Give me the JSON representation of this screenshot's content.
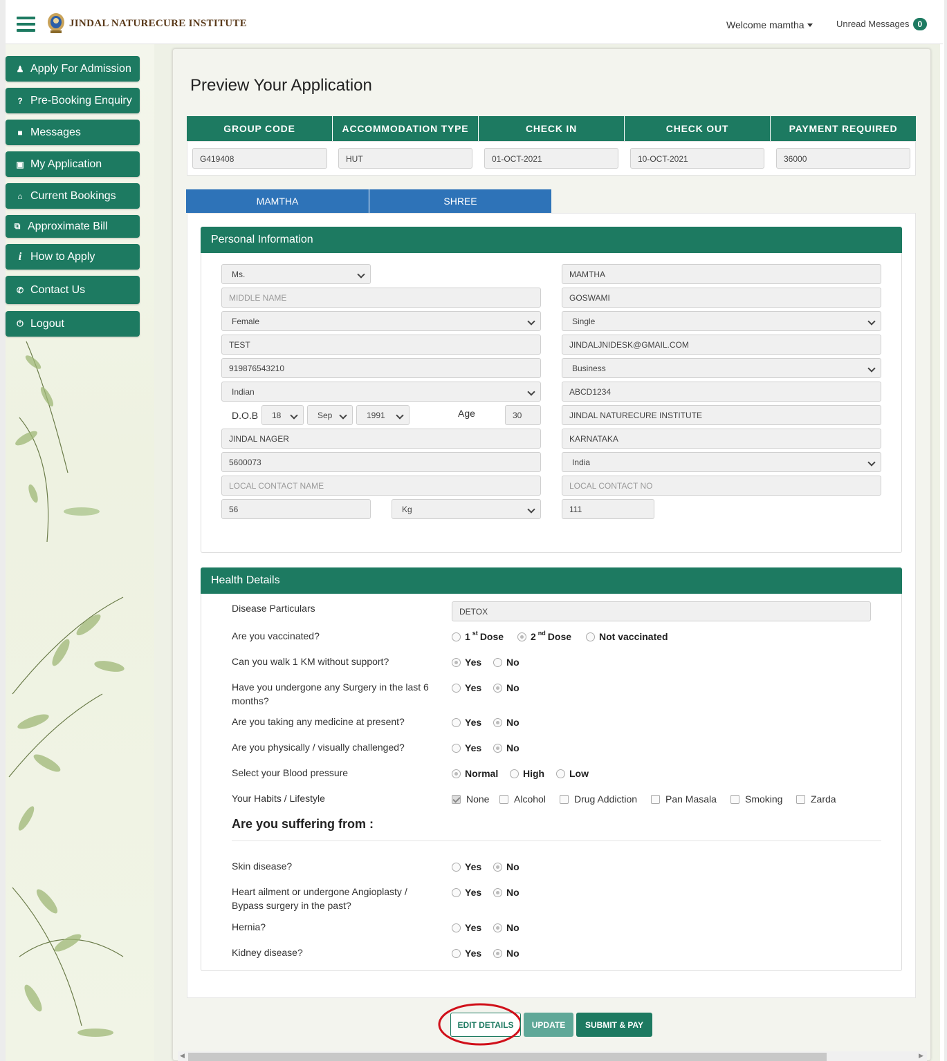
{
  "header": {
    "brand": "JINDAL NATURECURE INSTITUTE",
    "welcome": "Welcome mamtha",
    "unread_label": "Unread Messages",
    "unread_count": "0"
  },
  "sidebar": {
    "items": [
      {
        "label": "Apply For Admission",
        "icon": "user-icon"
      },
      {
        "label": "Pre-Booking Enquiry",
        "icon": "question-icon"
      },
      {
        "label": "Messages",
        "icon": "message-icon"
      },
      {
        "label": "My Application",
        "icon": "document-icon"
      },
      {
        "label": "Current Bookings",
        "icon": "home-icon"
      },
      {
        "label": "Approximate Bill",
        "icon": "copy-icon"
      },
      {
        "label": "How to Apply",
        "icon": "info-icon"
      },
      {
        "label": "Contact Us",
        "icon": "phone-icon"
      },
      {
        "label": "Logout",
        "icon": "power-icon"
      }
    ]
  },
  "page": {
    "title": "Preview Your Application"
  },
  "summary": {
    "headers": [
      "GROUP CODE",
      "ACCOMMODATION TYPE",
      "CHECK IN",
      "CHECK OUT",
      "PAYMENT REQUIRED"
    ],
    "values": [
      "G419408",
      "HUT",
      "01-OCT-2021",
      "10-OCT-2021",
      "36000"
    ]
  },
  "tabs": [
    "MAMTHA",
    "SHREE"
  ],
  "personal": {
    "title": "Personal Information",
    "salutation": "Ms.",
    "first_name": "MAMTHA",
    "middle_name_placeholder": "MIDDLE NAME",
    "last_name": "GOSWAMI",
    "gender": "Female",
    "marital_status": "Single",
    "occupation_text": "TEST",
    "email": "JINDALJNIDESK@GMAIL.COM",
    "phone": "919876543210",
    "profession": "Business",
    "nationality": "Indian",
    "id_number": "ABCD1234",
    "dob_label": "D.O.B",
    "dob_day": "18",
    "dob_month": "Sep",
    "dob_year": "1991",
    "age_label": "Age",
    "age": "30",
    "organisation": "JINDAL NATURECURE INSTITUTE",
    "address": "JINDAL NAGER",
    "state": "KARNATAKA",
    "pincode": "5600073",
    "country": "India",
    "local_contact_name_placeholder": "LOCAL CONTACT NAME",
    "local_contact_no_placeholder": "LOCAL CONTACT NO",
    "weight": "56",
    "weight_unit": "Kg",
    "height": "111"
  },
  "health": {
    "title": "Health Details",
    "disease_label": "Disease Particulars",
    "disease_value": "DETOX",
    "vaccinated_q": "Are you vaccinated?",
    "dose1": "Dose",
    "dose1_num": "1",
    "dose1_sup": "st",
    "dose2": "Dose",
    "dose2_num": "2",
    "dose2_sup": "nd",
    "not_vaccinated": "Not vaccinated",
    "walk_q": "Can you walk 1 KM without support?",
    "surgery_q": "Have you undergone any Surgery in the last 6 months?",
    "medicine_q": "Are you taking any medicine at present?",
    "challenged_q": "Are you physically / visually challenged?",
    "bp_q": "Select your Blood pressure",
    "bp_normal": "Normal",
    "bp_high": "High",
    "bp_low": "Low",
    "habits_q": "Your Habits / Lifestyle",
    "habits": [
      "None",
      "Alcohol",
      "Drug Addiction",
      "Pan Masala",
      "Smoking",
      "Zarda"
    ],
    "suffering_heading": "Are you suffering from :",
    "skin_q": "Skin disease?",
    "heart_q": "Heart ailment or undergone Angioplasty / Bypass surgery in the past?",
    "hernia_q": "Hernia?",
    "kidney_q": "Kidney disease?",
    "yes": "Yes",
    "no": "No"
  },
  "actions": {
    "edit": "EDIT DETAILS",
    "update": "UPDATE",
    "submit": "SUBMIT & PAY"
  },
  "colors": {
    "accent": "#1d7a61",
    "tab": "#2e73b8",
    "highlight": "#d0101a"
  }
}
